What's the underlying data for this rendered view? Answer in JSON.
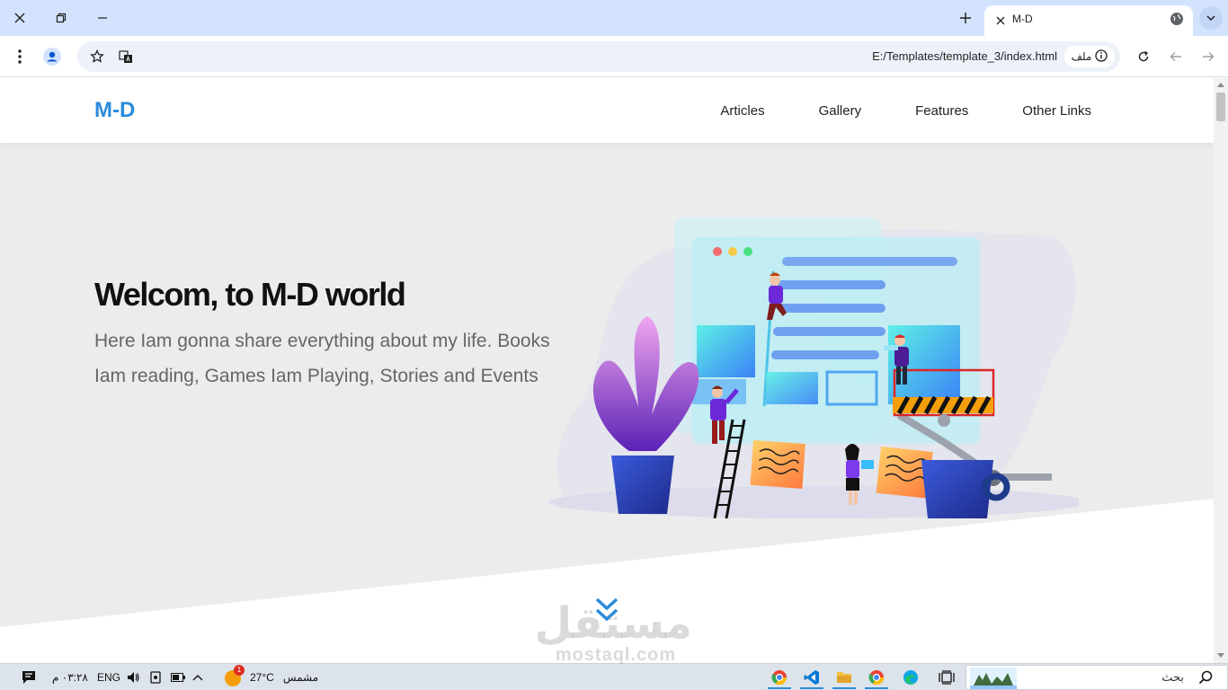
{
  "browser": {
    "tab_title": "M-D",
    "url": "E:/Templates/template_3/index.html",
    "site_chip_label": "ملف"
  },
  "site": {
    "logo": "M-D",
    "nav": [
      "Articles",
      "Gallery",
      "Features",
      "Other Links"
    ],
    "hero_title": "Welcom, to M-D world",
    "hero_text": "Here Iam gonna share everything about my life. Books Iam reading, Games Iam Playing, Stories and Events"
  },
  "watermark": {
    "arabic": "مستقل",
    "latin": "mostaql.com"
  },
  "taskbar": {
    "search_placeholder": "بحث",
    "weather_temp": "27°C",
    "weather_label": "مشمس",
    "weather_badge": "1",
    "language": "ENG",
    "time": "٠٣:٢٨ م"
  },
  "colors": {
    "accent": "#2b8bdb",
    "hero_bg": "#ececec",
    "chrome_tabbar": "#d3e3fd"
  }
}
